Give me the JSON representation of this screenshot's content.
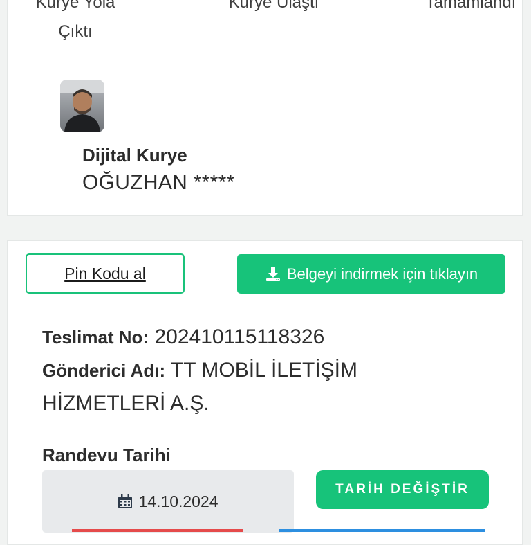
{
  "steps": [
    {
      "label": "Kurye Yola Çıktı"
    },
    {
      "label": "Kurye Ulaştı"
    },
    {
      "label": "Tamamlandı"
    }
  ],
  "courier": {
    "role": "Dijital Kurye",
    "name": "OĞUZHAN *****"
  },
  "actions": {
    "pin_label": "Pin Kodu al",
    "download_label": "Belgeyi indirmek için tıklayın"
  },
  "delivery": {
    "number_label": "Teslimat No:",
    "number_value": "202410115118326",
    "sender_label": "Gönderici Adı:",
    "sender_value_1": "TT MOBİL İLETİŞİM",
    "sender_value_2": "HİZMETLERİ A.Ş."
  },
  "appointment": {
    "label": "Randevu Tarihi",
    "date": "14.10.2024",
    "change_label": "TARİH DEĞİŞTİR"
  },
  "colors": {
    "accent_green": "#17c37a",
    "strip_red": "#e54b4b",
    "strip_blue": "#2d8fe0"
  },
  "icons": {
    "download": "download-icon",
    "calendar": "calendar-icon"
  }
}
